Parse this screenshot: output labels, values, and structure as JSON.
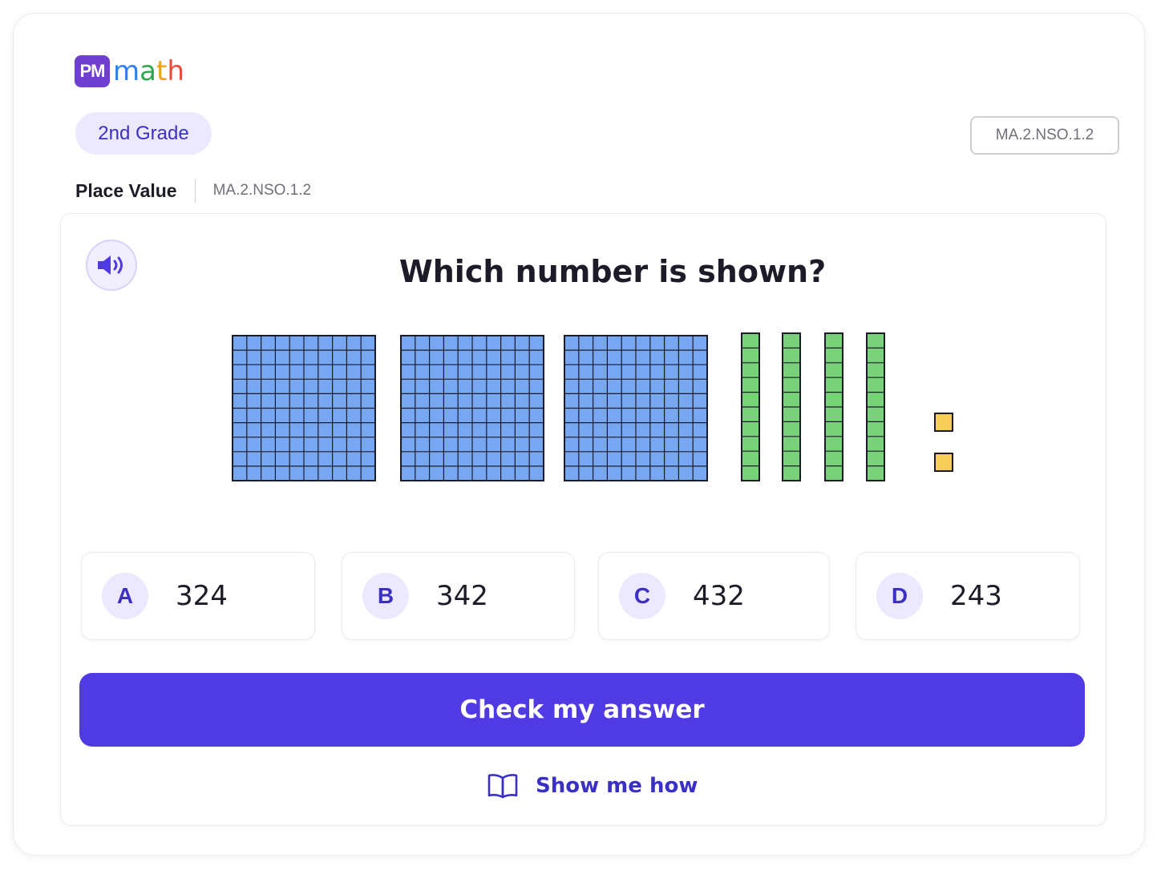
{
  "brand": {
    "badge": "PM",
    "word_letters": [
      {
        "ch": "m",
        "color": "#2f80ed"
      },
      {
        "ch": "a",
        "color": "#2fa84f"
      },
      {
        "ch": "t",
        "color": "#f2a20c"
      },
      {
        "ch": "h",
        "color": "#e74c3c"
      }
    ]
  },
  "grade": "2nd Grade",
  "standard_badge": "MA.2.NSO.1.2",
  "topic": {
    "label": "Place Value",
    "code": "MA.2.NSO.1.2"
  },
  "question": {
    "audio_icon": "speaker-icon",
    "text": "Which number is shown?",
    "blocks": {
      "hundreds": 3,
      "tens": 4,
      "ones": 2
    },
    "colors": {
      "hundreds": "#78a7f2",
      "tens": "#79d27a",
      "ones": "#f6cd59",
      "outline": "#1c1c28"
    }
  },
  "options": [
    {
      "letter": "A",
      "value": "324"
    },
    {
      "letter": "B",
      "value": "342"
    },
    {
      "letter": "C",
      "value": "432"
    },
    {
      "letter": "D",
      "value": "243"
    }
  ],
  "actions": {
    "check_label": "Check my answer",
    "show_how_icon": "book-icon",
    "show_how_label": "Show me how"
  },
  "colors": {
    "accent": "#4f3ae3",
    "accent_soft": "#ece8fd",
    "accent_text": "#3b30c4"
  }
}
